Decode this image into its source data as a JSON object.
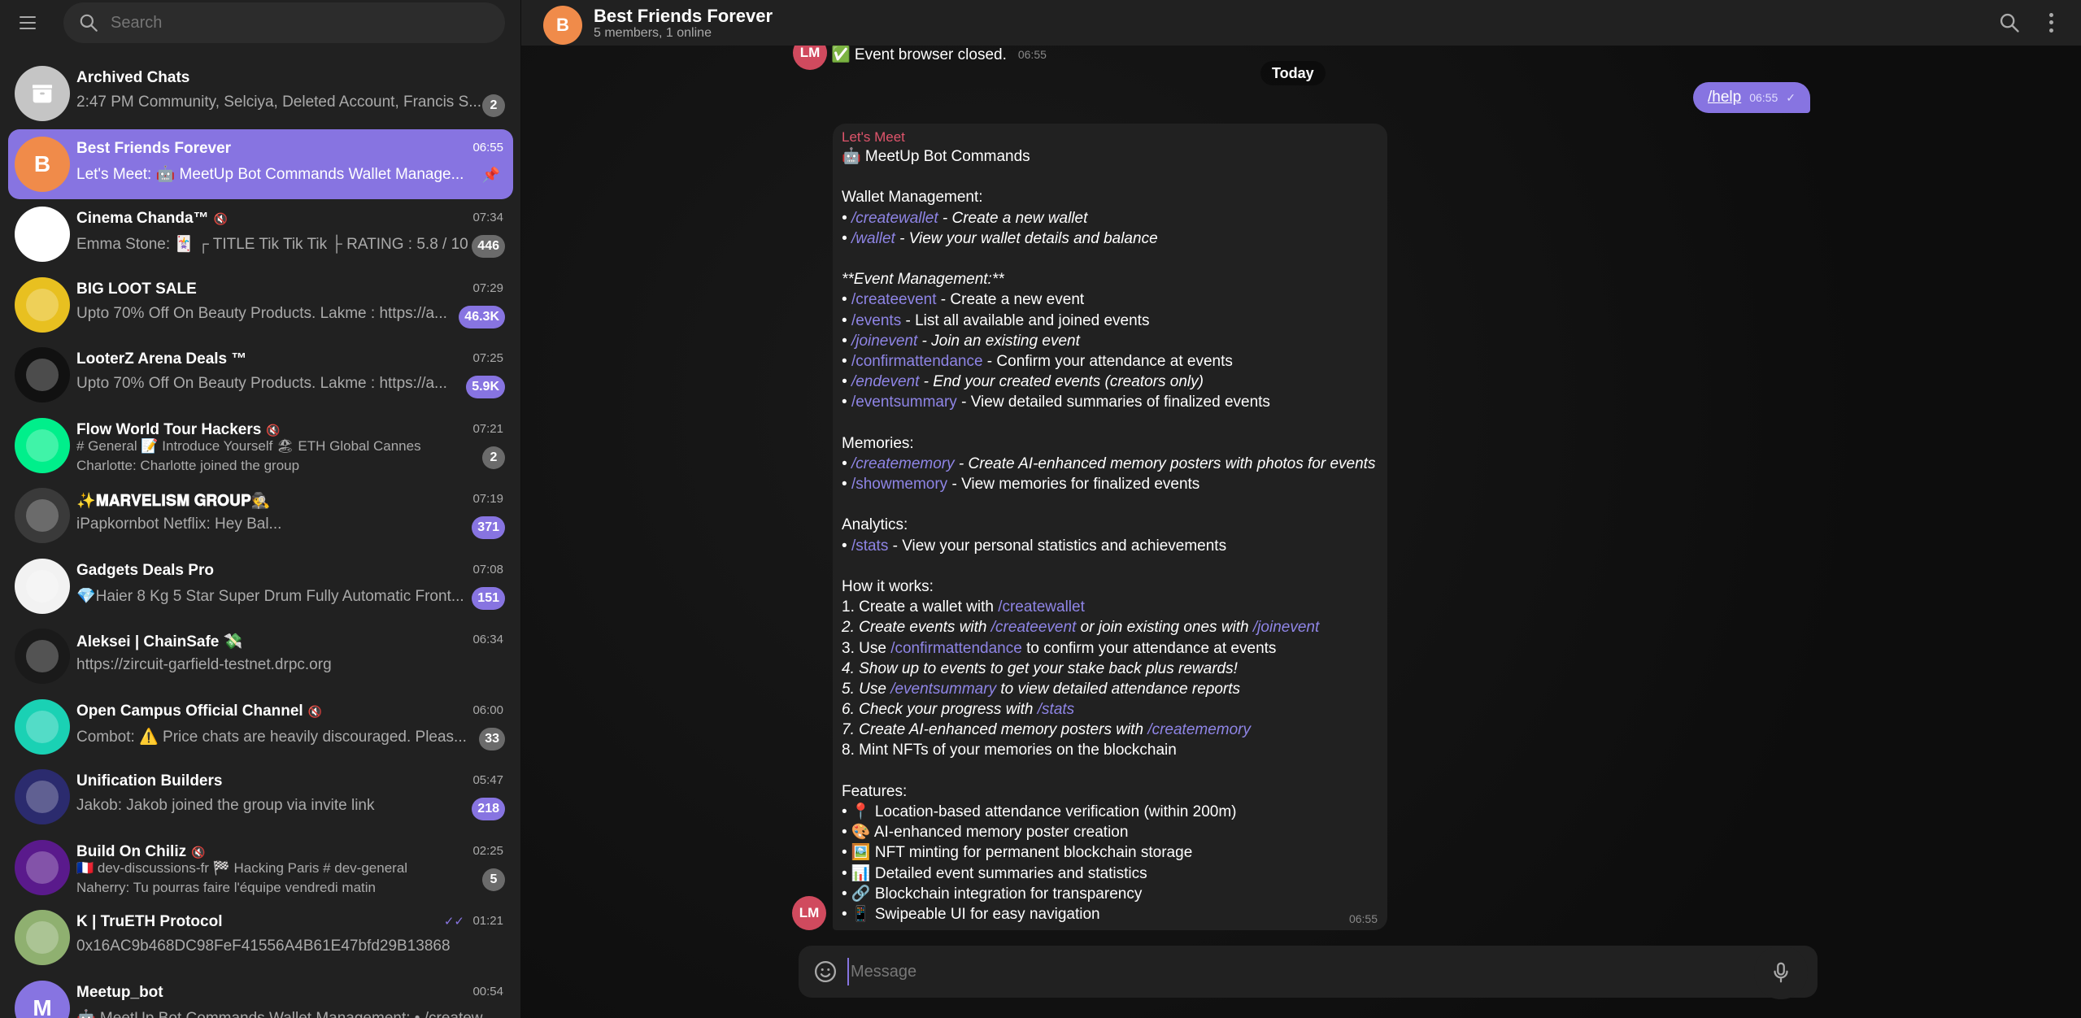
{
  "sidebar": {
    "search_placeholder": "Search",
    "chats": [
      {
        "title": "Archived Chats",
        "time": "",
        "preview": "2:47 PM Community, Selciya, Deleted Account, Francis S...",
        "badge": "2",
        "badge_muted": true,
        "avatar_text": "",
        "avatar_color": "#c5c5c5",
        "icon": "archive-icon"
      },
      {
        "title": "Best Friends Forever",
        "time": "06:55",
        "preview": "Let's Meet: 🤖 MeetUp Bot Commands Wallet Manage...",
        "badge": "",
        "avatar_text": "B",
        "avatar_color": "#f08b4a",
        "pinned": true,
        "active": true
      },
      {
        "title": "Cinema Chanda™",
        "time": "07:34",
        "preview": "Emma Stone: 🃏 ┌ TITLE Tik Tik Tik ├ RATING : 5.8 / 10 ...",
        "badge": "446",
        "badge_muted": true,
        "avatar_text": "",
        "avatar_color": "#ffffff",
        "muted": true
      },
      {
        "title": "BIG LOOT SALE",
        "time": "07:29",
        "preview": "Upto 70% Off On Beauty Products. Lakme : https://a...",
        "badge": "46.3K",
        "avatar_text": "",
        "avatar_color": "#e8c020"
      },
      {
        "title": "LooterZ Arena Deals ™",
        "time": "07:25",
        "preview": "Upto 70% Off On Beauty Products. Lakme : https://a...",
        "badge": "5.9K",
        "avatar_text": "",
        "avatar_color": "#111111"
      },
      {
        "title": "Flow World Tour Hackers",
        "time": "07:21",
        "preview": "# General 📝 Introduce Yourself 🏖 ETH Global Cannes",
        "preview2": "Charlotte: Charlotte joined the group",
        "badge": "2",
        "badge_muted": true,
        "avatar_text": "",
        "avatar_color": "#00ef8b",
        "muted": true
      },
      {
        "title": "✨𝐌𝐀𝐑𝐕𝐄𝐋𝐈𝐒𝐌 𝐆𝐑𝐎𝐔𝐏🕵",
        "time": "07:19",
        "preview": "iPapkornbot                Netflix: Hey Bal...",
        "badge": "371",
        "avatar_text": "",
        "avatar_color": "#3a3a3a"
      },
      {
        "title": "Gadgets Deals Pro",
        "time": "07:08",
        "preview": "💎Haier 8 Kg 5 Star Super Drum Fully Automatic Front...",
        "badge": "151",
        "avatar_text": "",
        "avatar_color": "#f2f2f2"
      },
      {
        "title": "Aleksei | ChainSafe 💸",
        "time": "06:34",
        "preview": "https://zircuit-garfield-testnet.drpc.org",
        "badge": "",
        "avatar_text": "",
        "avatar_color": "#1a1a1a"
      },
      {
        "title": "Open Campus Official Channel",
        "time": "06:00",
        "preview": "Combot: ⚠️ Price chats are heavily discouraged. Pleas...",
        "badge": "33",
        "badge_muted": true,
        "avatar_text": "",
        "avatar_color": "#1ad1b4",
        "muted": true
      },
      {
        "title": "Unification Builders",
        "time": "05:47",
        "preview": "Jakob: Jakob joined the group via invite link",
        "badge": "218",
        "avatar_text": "",
        "avatar_color": "#2b2b6e"
      },
      {
        "title": "Build On Chiliz",
        "time": "02:25",
        "preview": "🇫🇷 dev-discussions-fr 🏁 Hacking Paris # dev-general",
        "preview2": "Naherry: Tu pourras faire l'équipe vendredi matin",
        "badge": "5",
        "badge_muted": true,
        "avatar_text": "",
        "avatar_color": "#5a1a8c",
        "muted": true
      },
      {
        "title": "K | TruETH Protocol",
        "time": "01:21",
        "preview": "0x16AC9b468DC98FeF41556A4B61E47bfd29B13868",
        "badge": "",
        "avatar_text": "",
        "avatar_color": "#8fb070",
        "read": true
      },
      {
        "title": "Meetup_bot",
        "time": "00:54",
        "preview": "🤖 MeetUp Bot Commands Wallet Management: • /createw...",
        "badge": "",
        "avatar_text": "M",
        "avatar_color": "#8774e1"
      }
    ]
  },
  "header": {
    "avatar_text": "B",
    "title": "Best Friends Forever",
    "subtitle": "5 members, 1 online"
  },
  "messages": {
    "top_text": "✅ Event browser closed.",
    "top_time": "06:55",
    "top_avatar": "LM",
    "date_divider": "Today",
    "outgoing": {
      "text": "/help",
      "time": "06:55",
      "status": "✓"
    },
    "bot": {
      "sender": "Let's Meet",
      "time": "06:55",
      "avatar": "LM",
      "lines": [
        "🤖 MeetUp Bot Commands",
        "",
        "Wallet Management:",
        "• /createwallet - Create a new wallet",
        "• /wallet - View your wallet details and balance",
        "",
        "**Event Management:**",
        "• /createevent - Create a new event",
        "• /events - List all available and joined events",
        "• /joinevent - Join an existing event",
        "• /confirmattendance - Confirm your attendance at events",
        "• /endevent - End your created events (creators only)",
        "• /eventsummary - View detailed summaries of finalized events",
        "",
        "Memories:",
        "• /creatememory - Create AI-enhanced memory posters with photos for events",
        "• /showmemory - View memories for finalized events",
        "",
        "Analytics:",
        "• /stats - View your personal statistics and achievements",
        "",
        "How it works:",
        "1. Create a wallet with /createwallet",
        "2. Create events with /createevent or join existing ones with /joinevent",
        "3. Use /confirmattendance to confirm your attendance at events",
        "4. Show up to events to get your stake back plus rewards!",
        "5. Use /eventsummary to view detailed attendance reports",
        "6. Check your progress with /stats",
        "7. Create AI-enhanced memory posters with /creatememory",
        "8. Mint NFTs of your memories on the blockchain",
        "",
        "Features:",
        "• 📍 Location-based attendance verification (within 200m)",
        "• 🎨 AI-enhanced memory poster creation",
        "• 🖼️ NFT minting for permanent blockchain storage",
        "• 📊 Detailed event summaries and statistics",
        "• 🔗 Blockchain integration for transparency",
        "• 📱 Swipeable UI for easy navigation"
      ]
    }
  },
  "composer": {
    "placeholder": "Message"
  },
  "colors": {
    "accent": "#8774e1",
    "sidebar_bg": "#212121",
    "bot_sender": "#e0556c"
  }
}
